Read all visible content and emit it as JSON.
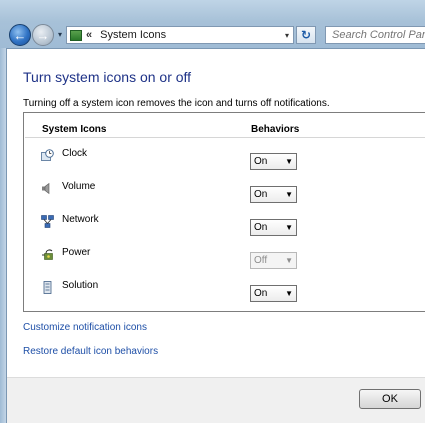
{
  "address_bar": {
    "chevrons": "«",
    "location": "System Icons",
    "dropdown_glyph": "▾",
    "folder_icon": "control-panel-icon"
  },
  "refresh": {
    "glyph": "↻",
    "icon": "refresh-icon"
  },
  "search": {
    "placeholder": "Search Control Panel"
  },
  "page": {
    "title": "Turn system icons on or off",
    "description": "Turning off a system icon removes the icon and turns off notifications."
  },
  "table": {
    "col_icons": "System Icons",
    "col_behaviors": "Behaviors",
    "rows": [
      {
        "label": "Clock",
        "value": "On",
        "icon": "clock-icon",
        "enabled": true
      },
      {
        "label": "Volume",
        "value": "On",
        "icon": "speaker-icon",
        "enabled": true
      },
      {
        "label": "Network",
        "value": "On",
        "icon": "network-icon",
        "enabled": true
      },
      {
        "label": "Power",
        "value": "Off",
        "icon": "power-icon",
        "enabled": false
      },
      {
        "label": "Solution",
        "value": "On",
        "icon": "solution-icon",
        "enabled": true
      }
    ]
  },
  "links": {
    "customize": "Customize notification icons",
    "restore": "Restore default icon behaviors"
  },
  "buttons": {
    "ok": "OK"
  },
  "colors": {
    "title": "#1e3287",
    "link": "#1e4fa7"
  }
}
